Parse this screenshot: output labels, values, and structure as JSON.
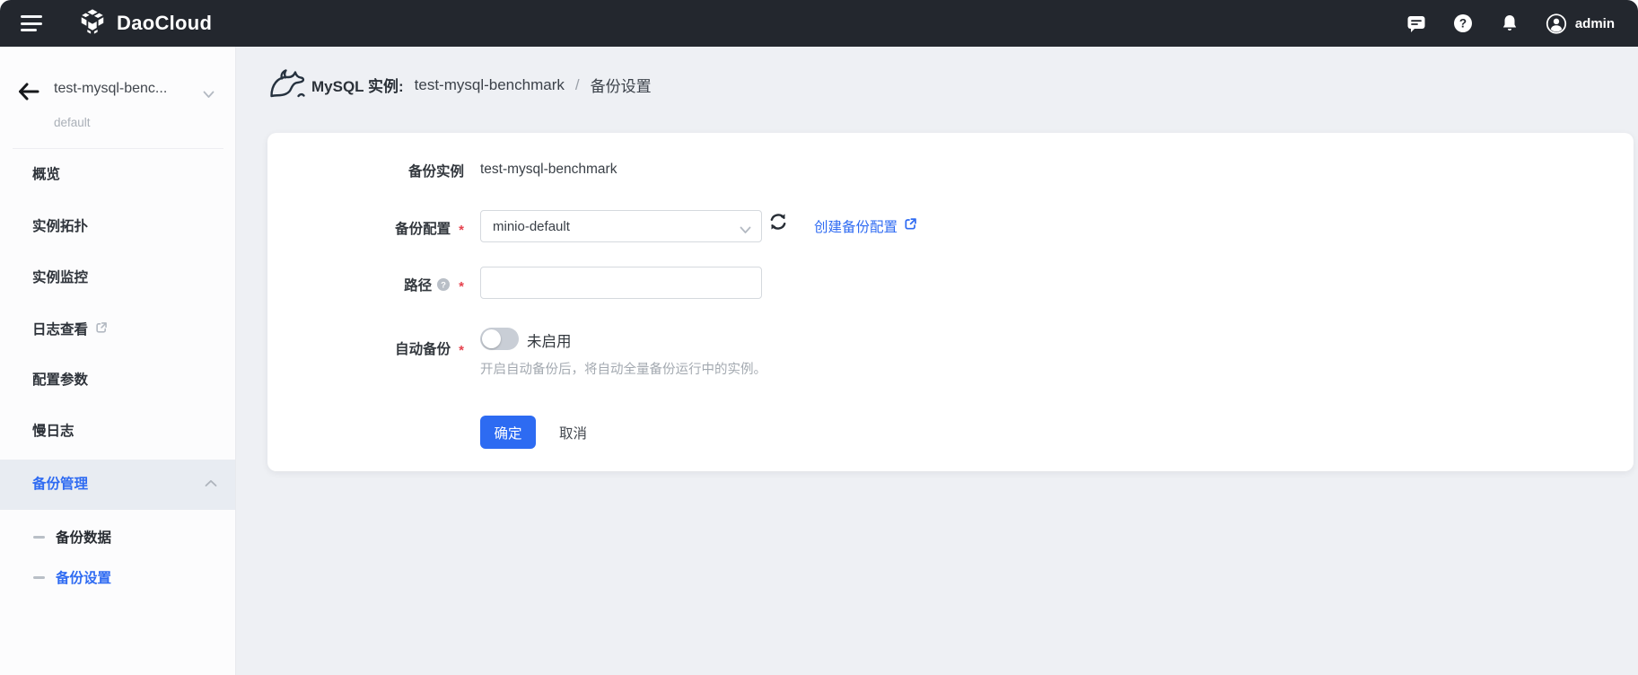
{
  "topbar": {
    "brand": "DaoCloud",
    "user": "admin",
    "help_mark": "?",
    "icons": [
      "menu-icon",
      "daocloud-logo-icon",
      "message-icon",
      "help-icon",
      "bell-icon",
      "avatar-icon"
    ]
  },
  "sidebar": {
    "back_title": "test-mysql-benc...",
    "namespace": "default",
    "items": [
      {
        "label": "概览"
      },
      {
        "label": "实例拓扑"
      },
      {
        "label": "实例监控"
      },
      {
        "label": "日志查看",
        "external": true
      },
      {
        "label": "配置参数"
      },
      {
        "label": "慢日志"
      },
      {
        "label": "备份管理",
        "active": true,
        "expanded": true
      }
    ],
    "subitems": [
      {
        "label": "备份数据"
      },
      {
        "label": "备份设置",
        "active": true
      }
    ]
  },
  "breadcrumb": {
    "prefix": "MySQL 实例:",
    "instance": "test-mysql-benchmark",
    "separator": "/",
    "current": "备份设置"
  },
  "form": {
    "required_mark": "*",
    "help_mark": "?",
    "instance": {
      "label": "备份实例",
      "value": "test-mysql-benchmark"
    },
    "config": {
      "label": "备份配置",
      "value": "minio-default",
      "create_link": "创建备份配置"
    },
    "path": {
      "label": "路径",
      "value": "",
      "placeholder": ""
    },
    "auto": {
      "label": "自动备份",
      "state": "未启用",
      "hint": "开启自动备份后，将自动全量备份运行中的实例。"
    },
    "ok_label": "确定",
    "cancel_label": "取消"
  },
  "colors": {
    "topbar_bg": "#23272e",
    "accent_blue": "#2d6bf2",
    "required_red": "#e6424e",
    "page_bg": "#eef0f4",
    "sidebar_active_bg": "#e8ecf2",
    "toggle_off": "#c9ced6"
  }
}
